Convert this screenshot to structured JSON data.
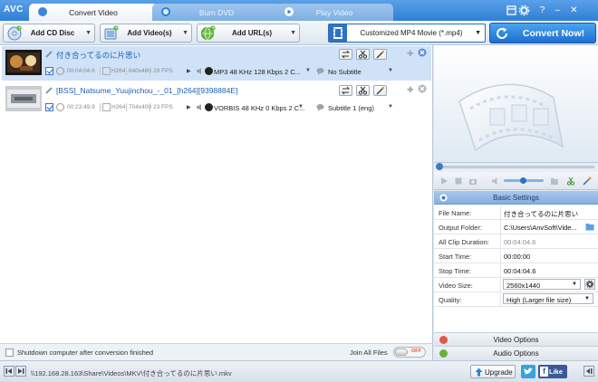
{
  "app": {
    "logo": "AVC"
  },
  "tabs": [
    {
      "label": "Convert Video"
    },
    {
      "label": "Burn DVD"
    },
    {
      "label": "Play Video"
    }
  ],
  "window_controls": {
    "help": "?",
    "minimize": "–",
    "close": "✕"
  },
  "toolbar": {
    "add_cd": "Add CD Disc",
    "add_video": "Add Video(s)",
    "add_url": "Add URL(s)",
    "profile": "Customized MP4 Movie (*.mp4)",
    "convert_now": "Convert Now!"
  },
  "files": [
    {
      "name": "付き合ってるのに片思い",
      "duration": "00:04:04.6",
      "codec": "H264",
      "resolution": "640x480",
      "fps": "29 FPS",
      "audio": "MP3 48 KHz 128 Kbps 2 C...",
      "subtitle": "No Subtitle"
    },
    {
      "name": "[BSS]_Natsume_Yuujinchou_-_01_[h264][9398884E]",
      "duration": "00:23:49.9",
      "codec": "H264",
      "resolution": "704x400",
      "fps": "23 FPS",
      "audio": "VORBIS 48 KHz 0 Kbps 2 C...",
      "subtitle": "Subtitle 1 (eng)"
    }
  ],
  "list_footer": {
    "shutdown": "Shutdown computer after conversion finished",
    "join": "Join All Files",
    "toggle_state": "OFF"
  },
  "settings": {
    "header": "Basic Settings",
    "rows": [
      {
        "key": "File Name:",
        "value": "付き合ってるのに片思い"
      },
      {
        "key": "Output Folder:",
        "value": "C:\\Users\\AnvSoft\\Vide..."
      },
      {
        "key": "All Clip Duration:",
        "value": "00:04:04.6"
      },
      {
        "key": "Start Time:",
        "value": "00:00:00"
      },
      {
        "key": "Stop Time:",
        "value": "00:04:04.6"
      },
      {
        "key": "Video Size:",
        "value": "2560x1440"
      },
      {
        "key": "Quality:",
        "value": "High (Larger file size)"
      }
    ],
    "video_options": "Video Options",
    "audio_options": "Audio Options"
  },
  "statusbar": {
    "path": "\\\\192.168.28.163\\Share\\Videos\\MKV\\付き合ってるのに片思い.mkv",
    "upgrade": "Upgrade",
    "like": "Like"
  },
  "colors": {
    "accent": "#2f7fd6",
    "convert_button": "#1f6fcf",
    "selected_row": "#cfe2f7",
    "settings_header": "#86afe0",
    "toggle_off": "#e05a3a"
  }
}
